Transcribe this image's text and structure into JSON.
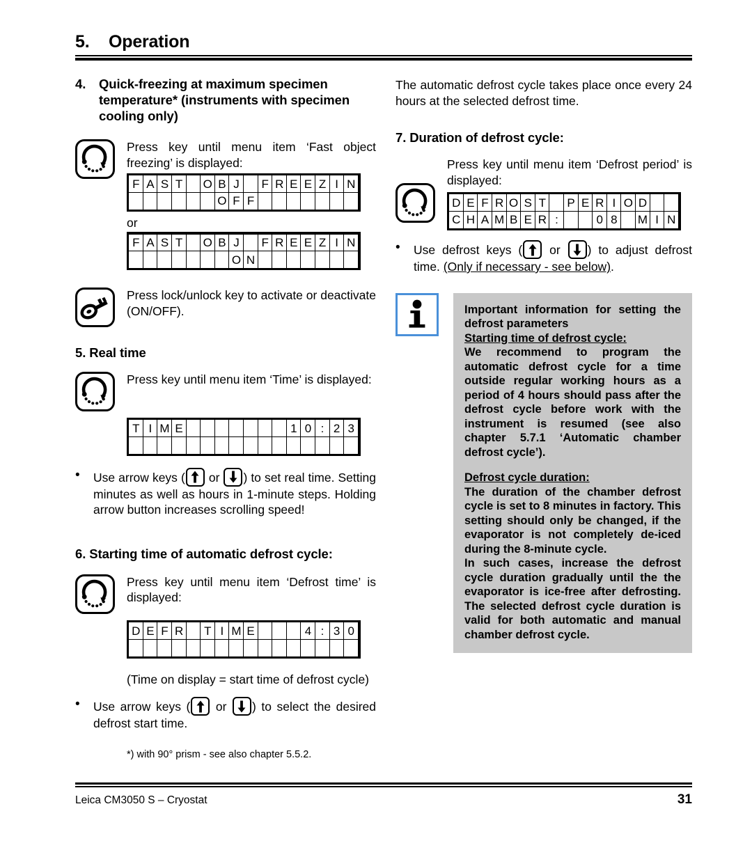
{
  "header": {
    "chapter_number": "5.",
    "chapter_title": "Operation"
  },
  "left_column": {
    "section4": {
      "number": "4.",
      "title": "Quick-freezing at maximum specimen temperature* (instruments with specimen cooling only)",
      "instruction": "Press key until menu item ‘Fast object freezing’ is displayed:",
      "icon": "menu-cycle-icon",
      "or_label": "or",
      "lcd_off": {
        "row1": [
          "F",
          "A",
          "S",
          "T",
          "",
          "O",
          "B",
          "J",
          "",
          "F",
          "R",
          "E",
          "E",
          "Z",
          "I",
          "N"
        ],
        "row2": [
          "",
          "",
          "",
          "",
          "",
          "",
          "O",
          "F",
          "F",
          "",
          "",
          "",
          "",
          "",
          "",
          ""
        ]
      },
      "lcd_on": {
        "row1": [
          "F",
          "A",
          "S",
          "T",
          "",
          "O",
          "B",
          "J",
          "",
          "F",
          "R",
          "E",
          "E",
          "Z",
          "I",
          "N"
        ],
        "row2": [
          "",
          "",
          "",
          "",
          "",
          "",
          "",
          "O",
          "N",
          "",
          "",
          "",
          "",
          "",
          "",
          ""
        ]
      },
      "lock_instruction": "Press lock/unlock key to activate or deactivate (ON/OFF).",
      "lock_icon": "key-icon"
    },
    "section5": {
      "number": "5.",
      "title": "Real time",
      "instruction": "Press key until menu item ‘Time’ is displayed:",
      "icon": "menu-cycle-icon",
      "lcd_time": {
        "row1": [
          "T",
          "I",
          "M",
          "E",
          "",
          "",
          "",
          "",
          "",
          "",
          "",
          "1",
          "0",
          ":",
          "2",
          "3"
        ],
        "row2": [
          "",
          "",
          "",
          "",
          "",
          "",
          "",
          "",
          "",
          "",
          "",
          "",
          "",
          "",
          "",
          ""
        ]
      },
      "bullet": {
        "marker": "•",
        "part1": "Use arrow keys (",
        "or": " or ",
        "part2": ") to set real time. Setting minutes as well as hours in 1-minute steps. Holding arrow button increases scrolling speed!",
        "up_icon": "arrow-up-icon",
        "down_icon": "arrow-down-icon"
      }
    },
    "section6": {
      "number": "6.",
      "title": "Starting time of automatic defrost cycle:",
      "instruction": "Press key until menu item ‘Defrost time’ is displayed:",
      "icon": "menu-cycle-icon",
      "lcd_defr": {
        "row1": [
          "D",
          "E",
          "F",
          "R",
          "",
          "T",
          "I",
          "M",
          "E",
          "",
          "",
          "",
          "4",
          ":",
          "3",
          "0"
        ],
        "row2": [
          "",
          "",
          "",
          "",
          "",
          "",
          "",
          "",
          "",
          "",
          "",
          "",
          "",
          "",
          "",
          ""
        ]
      },
      "note": "(Time on display = start time of defrost cycle)",
      "bullet": {
        "marker": "•",
        "part1": "Use arrow keys (",
        "or": " or ",
        "part2": ") to select the desired defrost start time.",
        "up_icon": "arrow-up-icon",
        "down_icon": "arrow-down-icon"
      }
    },
    "footnote": "*) with 90° prism - see also chapter 5.5.2."
  },
  "right_column": {
    "intro": "The automatic defrost cycle takes place once every 24 hours at the selected defrost time.",
    "section7": {
      "number": "7.",
      "title": "Duration of defrost cycle:",
      "instruction": "Press key until menu item ‘Defrost period’ is displayed:",
      "icon": "menu-cycle-icon",
      "lcd_period": {
        "row1": [
          "D",
          "E",
          "F",
          "R",
          "O",
          "S",
          "T",
          "",
          "P",
          "E",
          "R",
          "I",
          "O",
          "D",
          "",
          ""
        ],
        "row2": [
          "C",
          "H",
          "A",
          "M",
          "B",
          "E",
          "R",
          ":",
          "",
          "",
          "0",
          "8",
          "",
          "M",
          "I",
          "N"
        ]
      },
      "bullet": {
        "marker": "•",
        "part1": "Use defrost keys (",
        "or": " or ",
        "part2": ") to adjust defrost time. ",
        "underlined": "(Only if necessary - see below)",
        "part3": ".",
        "up_icon": "arrow-up-icon",
        "down_icon": "arrow-down-icon"
      }
    },
    "note_box": {
      "icon": "info-icon",
      "icon_border_color": "#4a90d9",
      "background_color": "#c8c8c8",
      "title": "Important information for setting the defrost parameters",
      "subhead1": "Starting time of defrost cycle:",
      "para1": "We recommend to program the automatic defrost cycle for a time outside regular working hours as a period of 4 hours should pass after the defrost cycle before work with the instrument is resumed (see also chapter 5.7.1 ‘Automatic chamber defrost cycle’).",
      "subhead2": "Defrost cycle duration:",
      "para2": "The duration of the chamber defrost cycle is set to 8 minutes in factory. This setting should only be changed, if the evaporator is not completely de-iced during the 8-minute cycle.",
      "para3": "In such cases, increase the defrost cycle duration gradually until the the evaporator is ice-free after defrosting. The selected defrost cycle duration is valid for both automatic and manual chamber defrost cycle."
    }
  },
  "footer": {
    "document_title": "Leica CM3050 S – Cryostat",
    "page_number": "31"
  }
}
